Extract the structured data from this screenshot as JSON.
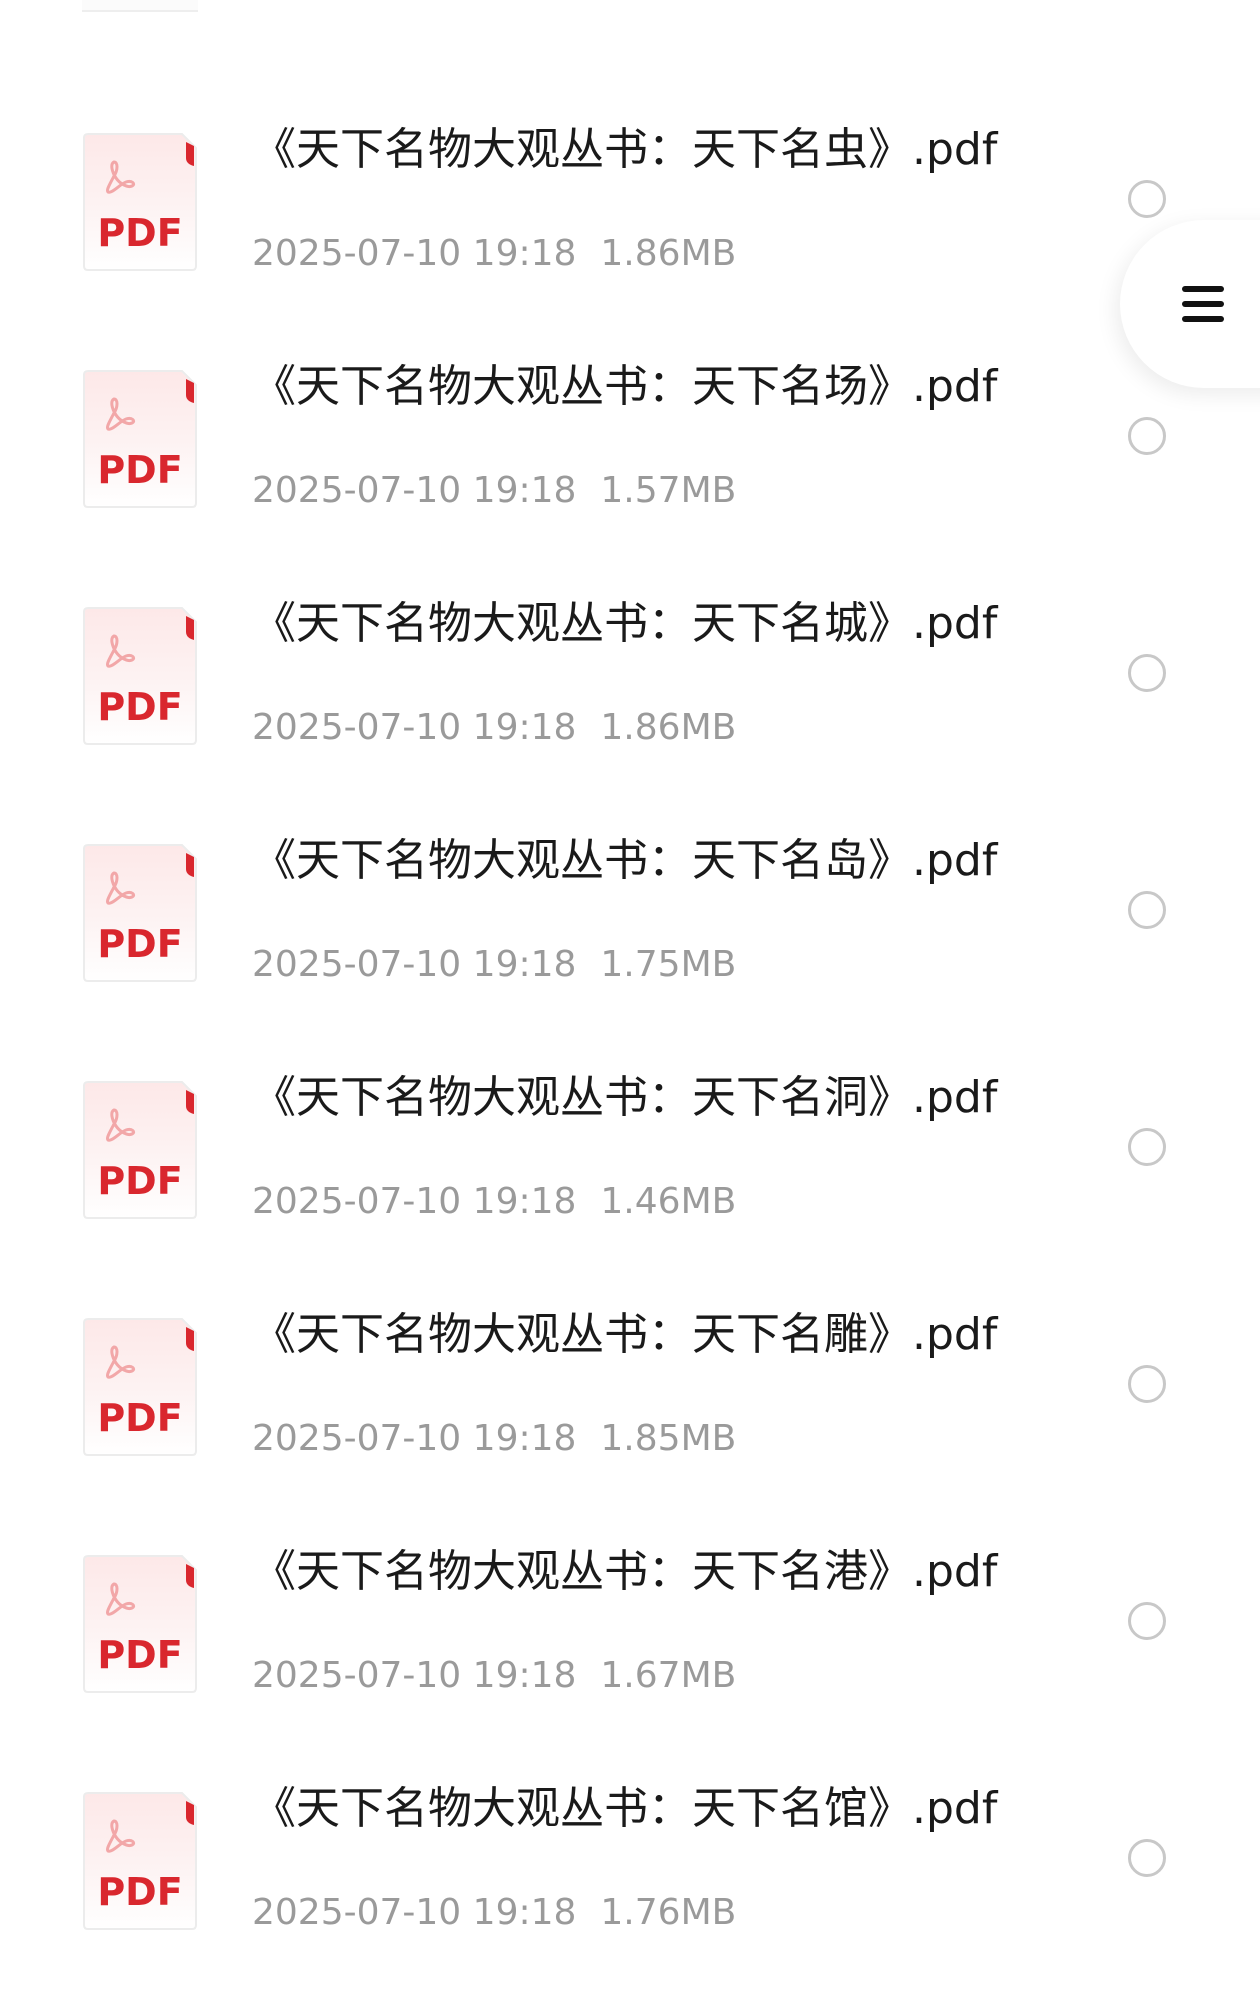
{
  "files": [
    {
      "name": "《天下名物大观丛书：天下名虫》.pdf",
      "date": "2025-07-10 19:18",
      "size": "1.86MB",
      "icon": "pdf-file-icon",
      "icon_label": "PDF"
    },
    {
      "name": "《天下名物大观丛书：天下名场》.pdf",
      "date": "2025-07-10 19:18",
      "size": "1.57MB",
      "icon": "pdf-file-icon",
      "icon_label": "PDF"
    },
    {
      "name": "《天下名物大观丛书：天下名城》.pdf",
      "date": "2025-07-10 19:18",
      "size": "1.86MB",
      "icon": "pdf-file-icon",
      "icon_label": "PDF"
    },
    {
      "name": "《天下名物大观丛书：天下名岛》.pdf",
      "date": "2025-07-10 19:18",
      "size": "1.75MB",
      "icon": "pdf-file-icon",
      "icon_label": "PDF"
    },
    {
      "name": "《天下名物大观丛书：天下名洞》.pdf",
      "date": "2025-07-10 19:18",
      "size": "1.46MB",
      "icon": "pdf-file-icon",
      "icon_label": "PDF"
    },
    {
      "name": "《天下名物大观丛书：天下名雕》.pdf",
      "date": "2025-07-10 19:18",
      "size": "1.85MB",
      "icon": "pdf-file-icon",
      "icon_label": "PDF"
    },
    {
      "name": "《天下名物大观丛书：天下名港》.pdf",
      "date": "2025-07-10 19:18",
      "size": "1.67MB",
      "icon": "pdf-file-icon",
      "icon_label": "PDF"
    },
    {
      "name": "《天下名物大观丛书：天下名馆》.pdf",
      "date": "2025-07-10 19:18",
      "size": "1.76MB",
      "icon": "pdf-file-icon",
      "icon_label": "PDF"
    }
  ],
  "colors": {
    "pdf_red": "#d9272e",
    "title_text": "#1a1a1a",
    "meta_text": "#9a9a9a",
    "radio_border": "#c8c8c8"
  },
  "float_menu": {
    "icon": "hamburger-menu-icon"
  }
}
